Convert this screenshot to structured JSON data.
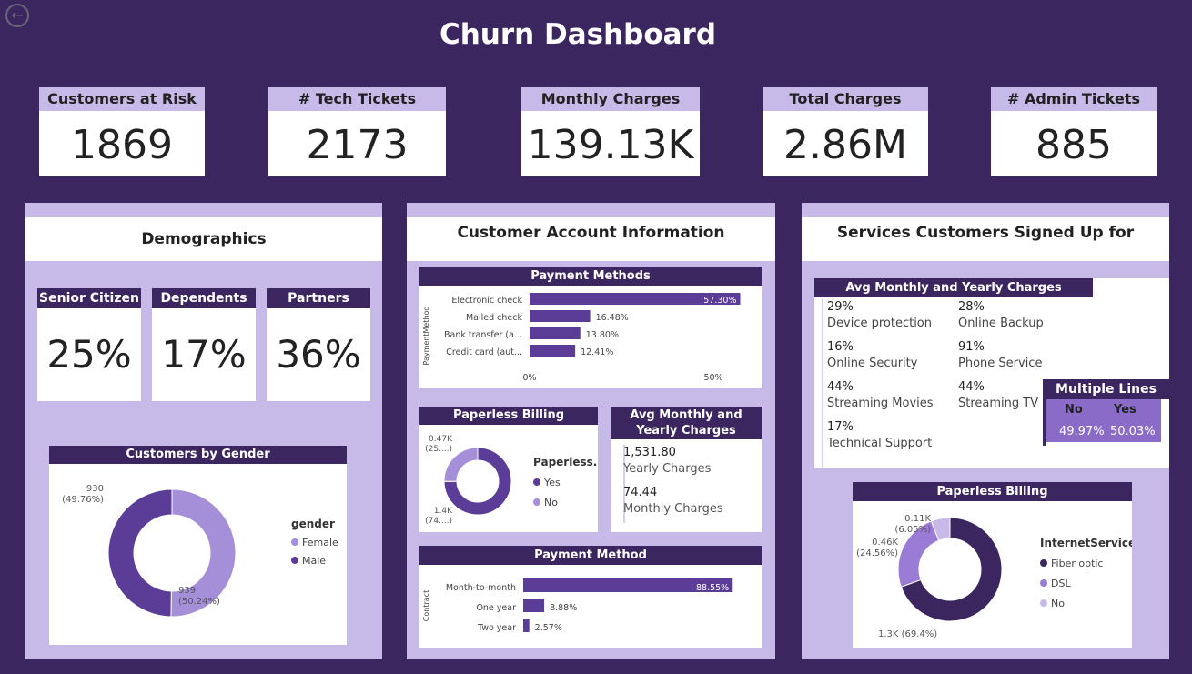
{
  "title": "Churn Dashboard",
  "kpis": [
    {
      "label": "Customers at Risk",
      "value": "1869"
    },
    {
      "label": "# Tech Tickets",
      "value": "2173"
    },
    {
      "label": "Monthly Charges",
      "value": "139.13K"
    },
    {
      "label": "Total Charges",
      "value": "2.86M"
    },
    {
      "label": "# Admin Tickets",
      "value": "885"
    }
  ],
  "demographics": {
    "title": "Demographics",
    "cards": [
      {
        "label": "Senior Citizen",
        "value": "25%"
      },
      {
        "label": "Dependents",
        "value": "17%"
      },
      {
        "label": "Partners",
        "value": "36%"
      }
    ]
  },
  "account": {
    "title": "Customer Account Information",
    "avg_card": {
      "title": "Avg Monthly and Yearly Charges",
      "yearly_value": "1,531.80",
      "yearly_label": "Yearly Charges",
      "monthly_value": "74.44",
      "monthly_label": "Monthly Charges"
    }
  },
  "services": {
    "title": "Services Customers Signed Up for",
    "avg_card": {
      "title": "Avg Monthly and Yearly Charges",
      "items": [
        {
          "pct": "29%",
          "name": "Device protection"
        },
        {
          "pct": "28%",
          "name": "Online Backup"
        },
        {
          "pct": "16%",
          "name": "Online Security"
        },
        {
          "pct": "91%",
          "name": "Phone Service"
        },
        {
          "pct": "44%",
          "name": "Streaming Movies"
        },
        {
          "pct": "44%",
          "name": "Streaming TV"
        },
        {
          "pct": "17%",
          "name": "Technical Support"
        }
      ]
    },
    "multiple_lines": {
      "title": "Multiple Lines",
      "headers": [
        "No",
        "Yes"
      ],
      "values": [
        "49.97%",
        "50.03%"
      ]
    }
  },
  "colors": {
    "dark": "#3b2660",
    "bar": "#5b3d98",
    "light": "#a58fd8",
    "lighter": "#c7b9e8"
  },
  "chart_data": [
    {
      "type": "pie",
      "title": "Customers by Gender",
      "legend_title": "gender",
      "categories": [
        "Female",
        "Male"
      ],
      "values": [
        939,
        930
      ],
      "labels": [
        "939\n(50.24%)",
        "930\n(49.76%)"
      ]
    },
    {
      "type": "bar",
      "title": "Payment Methods",
      "ylabel": "PaymentMethod",
      "categories": [
        "Electronic check",
        "Mailed check",
        "Bank transfer (a...",
        "Credit card (aut..."
      ],
      "values": [
        57.3,
        16.48,
        13.8,
        12.41
      ],
      "value_labels": [
        "57.30%",
        "16.48%",
        "13.80%",
        "12.41%"
      ],
      "xticks": [
        "0%",
        "50%"
      ],
      "xlim": [
        0,
        50
      ]
    },
    {
      "type": "pie",
      "title": "Paperless Billing",
      "legend_title": "Paperless...",
      "categories": [
        "Yes",
        "No"
      ],
      "values": [
        1.4,
        0.47
      ],
      "labels": [
        "1.4K\n(74....)",
        "0.47K\n(25....)"
      ]
    },
    {
      "type": "bar",
      "title": "Payment Method",
      "ylabel": "Contract",
      "categories": [
        "Month-to-month",
        "One year",
        "Two year"
      ],
      "values": [
        88.55,
        8.88,
        2.57
      ],
      "value_labels": [
        "88.55%",
        "8.88%",
        "2.57%"
      ]
    },
    {
      "type": "pie",
      "title": "Paperless Billing",
      "legend_title": "InternetService",
      "categories": [
        "Fiber optic",
        "DSL",
        "No"
      ],
      "values": [
        1.3,
        0.46,
        0.11
      ],
      "labels": [
        "1.3K (69.4%)",
        "0.46K\n(24.56%)",
        "0.11K\n(6.05%)"
      ]
    }
  ]
}
